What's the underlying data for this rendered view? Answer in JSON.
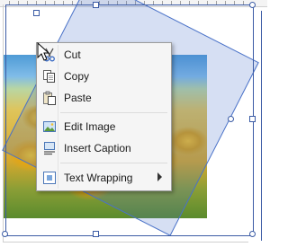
{
  "context_menu": {
    "items": [
      {
        "label": "Cut",
        "icon": "scissors-icon"
      },
      {
        "label": "Copy",
        "icon": "copy-icon"
      },
      {
        "label": "Paste",
        "icon": "paste-icon"
      },
      {
        "label": "Edit Image",
        "icon": "edit-image-icon"
      },
      {
        "label": "Insert Caption",
        "icon": "insert-caption-icon"
      },
      {
        "label": "Text Wrapping",
        "icon": "text-wrapping-icon",
        "has_submenu": true
      }
    ]
  },
  "colors": {
    "selection": "#3b5ba5",
    "menu_background": "#f5f5f5"
  }
}
